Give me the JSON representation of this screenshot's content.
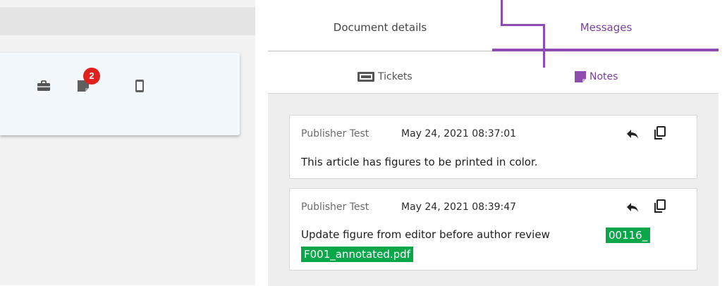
{
  "tabs": [
    {
      "label": "Document details",
      "active": false
    },
    {
      "label": "Messages",
      "active": true
    }
  ],
  "subtabs": [
    {
      "label": "Tickets",
      "icon": "ticket-icon",
      "active": false
    },
    {
      "label": "Notes",
      "icon": "note-icon",
      "active": true
    }
  ],
  "left_card": {
    "icons": [
      "briefcase-icon",
      "note-icon",
      "mobile-device-icon"
    ],
    "badge_count": "2"
  },
  "notes": [
    {
      "author": "Publisher Test",
      "timestamp": "May 24, 2021 08:37:01",
      "text": "This article has figures to be printed in color.",
      "attachment": null
    },
    {
      "author": "Publisher Test",
      "timestamp": "May 24, 2021 08:39:47",
      "text": "Update figure from editor before author review",
      "attachment_line1": "00116_",
      "attachment_line2": "F001_annotated.pdf"
    }
  ],
  "colors": {
    "accent": "#8e4bb0",
    "badge": "#e0201f",
    "attachment": "#0aa64a"
  }
}
